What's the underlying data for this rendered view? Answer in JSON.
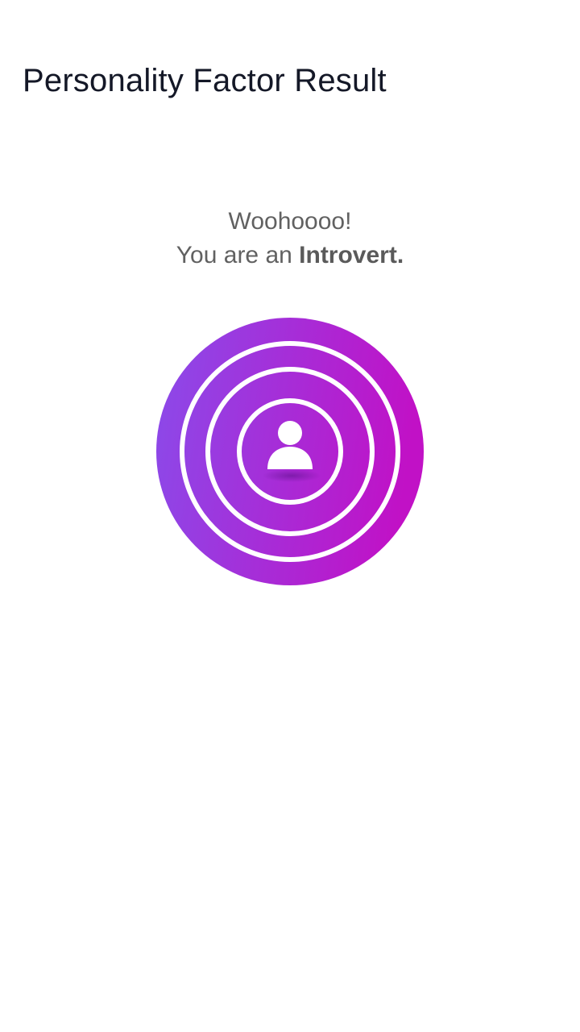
{
  "header": {
    "title": "Personality Factor Result"
  },
  "result": {
    "greeting": "Woohoooo!",
    "prefix": "You are an ",
    "type": "Introvert",
    "suffix": "."
  },
  "badge": {
    "icon": "person-icon",
    "gradient_start": "#8a4bea",
    "gradient_end": "#c111c6",
    "ring_color": "#ffffff"
  }
}
